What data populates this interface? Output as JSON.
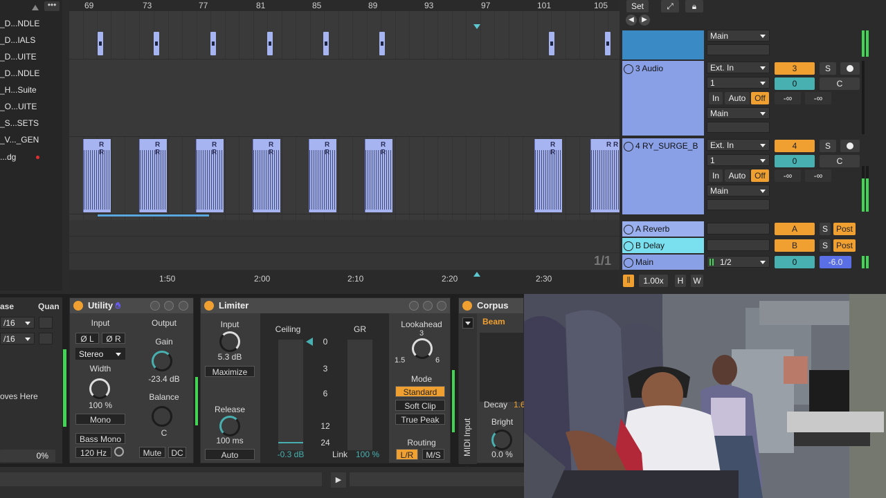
{
  "browser": {
    "items": [
      "_D...NDLE",
      "_D...IALS",
      "_D...UITE",
      "_D...NDLE",
      "_H...Suite",
      "_O...UITE",
      "_S...SETS",
      "_V..._GEN",
      "...dg"
    ]
  },
  "arrangement": {
    "bar_numbers": [
      "69",
      "73",
      "77",
      "81",
      "85",
      "89",
      "93",
      "97",
      "101",
      "105"
    ],
    "time_labels": [
      "1:50",
      "2:00",
      "2:10",
      "2:20",
      "2:30"
    ],
    "loop_counter": "1/1"
  },
  "transport": {
    "set_label": "Set",
    "zoom": "1.00x",
    "h_label": "H",
    "w_label": "W"
  },
  "mixer": {
    "main_top": "Main",
    "tracks": [
      {
        "name": "3 Audio",
        "input_type": "Ext. In",
        "channel": "1",
        "number": "3",
        "solo": "S",
        "pan": "0",
        "pan_c": "C",
        "in": "In",
        "auto": "Auto",
        "off": "Off",
        "vol": "-∞",
        "send": "-∞",
        "output": "Main"
      },
      {
        "name": "4 RY_SURGE_B",
        "input_type": "Ext. In",
        "channel": "1",
        "number": "4",
        "solo": "S",
        "pan": "0",
        "pan_c": "C",
        "in": "In",
        "auto": "Auto",
        "off": "Off",
        "vol": "-∞",
        "send": "-∞",
        "output": "Main"
      }
    ],
    "returns": [
      {
        "name": "A Reverb",
        "letter": "A",
        "solo": "S",
        "post": "Post"
      },
      {
        "name": "B Delay",
        "letter": "B",
        "solo": "S",
        "post": "Post"
      }
    ],
    "main": {
      "name": "Main",
      "routing": "1/2",
      "pan": "0",
      "volume": "-6.0"
    }
  },
  "devices": {
    "left_panel": {
      "col_a": "ase",
      "col_b": "Quan",
      "q1": "/16",
      "q2": "/16",
      "hint": "oves Here",
      "pct": "0%"
    },
    "utility": {
      "title": "Utility",
      "input": "Input",
      "output": "Output",
      "phase_l": "Ø L",
      "phase_r": "Ø R",
      "gain": "Gain",
      "stereo": "Stereo",
      "width": "Width",
      "gain_value": "-23.4 dB",
      "width_value": "100 %",
      "balance": "Balance",
      "mono": "Mono",
      "balance_value": "C",
      "bass_mono": "Bass Mono",
      "freq": "120 Hz",
      "mute": "Mute",
      "dc": "DC"
    },
    "limiter": {
      "title": "Limiter",
      "input": "Input",
      "ceiling": "Ceiling",
      "gr": "GR",
      "lookahead": "Lookahead",
      "input_value": "5.3 dB",
      "maximize": "Maximize",
      "lookahead_value": "3",
      "lh_min": "1.5",
      "lh_max": "6",
      "scale": [
        "0",
        "3",
        "6",
        "12",
        "24"
      ],
      "mode": "Mode",
      "standard": "Standard",
      "soft_clip": "Soft Clip",
      "true_peak": "True Peak",
      "release": "Release",
      "release_value": "100 ms",
      "auto": "Auto",
      "ceiling_value": "-0.3 dB",
      "link": "Link",
      "link_value": "100 %",
      "routing": "Routing",
      "lr": "L/R",
      "ms": "M/S"
    },
    "corpus": {
      "title": "Corpus",
      "preset": "Beam",
      "decay": "Decay",
      "decay_value": "1.6",
      "bright": "Bright",
      "bright_value": "0.0 %",
      "midi": "MIDI Input"
    }
  }
}
